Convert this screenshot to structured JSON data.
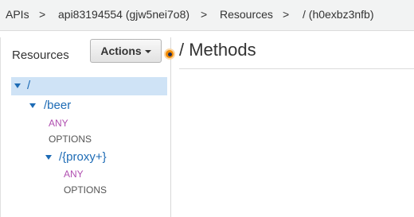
{
  "breadcrumb": {
    "items": [
      "APIs",
      "api83194554 (gjw5nei7o8)",
      "Resources",
      "/ (h0exbz3nfb)"
    ],
    "separator": ">"
  },
  "sidebar": {
    "title": "Resources",
    "actions_label": "Actions"
  },
  "main": {
    "title": "/ Methods"
  },
  "tree": {
    "root": "/",
    "beer": {
      "path": "/beer",
      "methods": [
        "ANY",
        "OPTIONS"
      ]
    },
    "proxy": {
      "path": "/{proxy+}",
      "methods": [
        "ANY",
        "OPTIONS"
      ]
    }
  },
  "colors": {
    "link": "#1d6bb5",
    "any_method": "#b04fb0",
    "selected_bg": "#cfe3f6",
    "handle": "#f28b00"
  }
}
